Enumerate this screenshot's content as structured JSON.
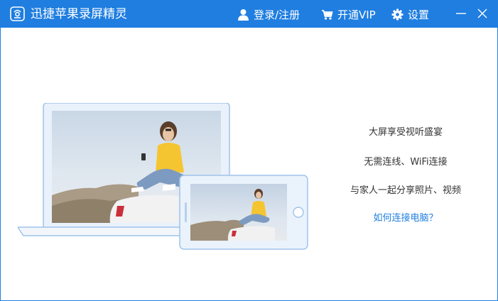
{
  "window": {
    "title": "迅捷苹果录屏精灵",
    "accent_color": "#1f7ee0"
  },
  "titlebar": {
    "logo_icon": "screen-recorder-logo-icon",
    "login": {
      "icon": "user-icon",
      "label": "登录/注册"
    },
    "vip": {
      "icon": "cart-icon",
      "label": "开通VIP"
    },
    "settings": {
      "icon": "gear-icon",
      "label": "设置"
    },
    "minimize_icon": "minimize-icon",
    "close_icon": "close-icon"
  },
  "main": {
    "illustration": {
      "devices": [
        "laptop",
        "phone"
      ],
      "photo_subject": "woman sitting on car with phone"
    },
    "features": [
      "大屏享受视听盛宴",
      "无需连线、WiFi连接",
      "与家人一起分享照片、视频"
    ],
    "help_link": "如何连接电脑？"
  }
}
